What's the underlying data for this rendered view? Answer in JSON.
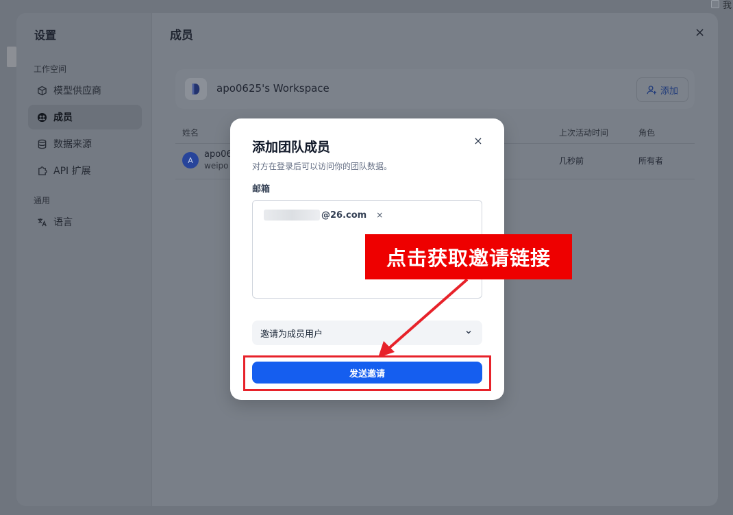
{
  "background": {
    "top_right_char": "我"
  },
  "sidebar": {
    "title": "设置",
    "groups": [
      {
        "label": "工作空间",
        "items": [
          {
            "label": "模型供应商",
            "icon": "cube-icon",
            "active": false
          },
          {
            "label": "成员",
            "icon": "members-icon",
            "active": true
          },
          {
            "label": "数据来源",
            "icon": "database-icon",
            "active": false
          },
          {
            "label": "API 扩展",
            "icon": "puzzle-icon",
            "active": false
          }
        ]
      },
      {
        "label": "通用",
        "items": [
          {
            "label": "语言",
            "icon": "translate-icon",
            "active": false
          }
        ]
      }
    ]
  },
  "main": {
    "title": "成员",
    "close_label": "×",
    "workspace": {
      "name": "apo0625's Workspace",
      "add_label": "添加"
    },
    "table": {
      "headers": {
        "name": "姓名",
        "last_active": "上次活动时间",
        "role": "角色"
      },
      "rows": [
        {
          "avatar": "A",
          "name": "apo06",
          "email": "weipo",
          "last_active": "几秒前",
          "role": "所有者"
        }
      ]
    }
  },
  "modal": {
    "title": "添加团队成员",
    "description": "对方在登录后可以访问你的团队数据。",
    "close_label": "×",
    "email_label": "邮箱",
    "email_tag": {
      "domain": "@26.com",
      "remove_label": "×"
    },
    "role_select": {
      "value": "邀请为成员用户"
    },
    "send_button": "发送邀请"
  },
  "annotation": {
    "callout_text": "点击获取邀请链接",
    "color": "#ee0000"
  },
  "colors": {
    "primary": "#155eef",
    "annotation_red": "#e7222a"
  }
}
